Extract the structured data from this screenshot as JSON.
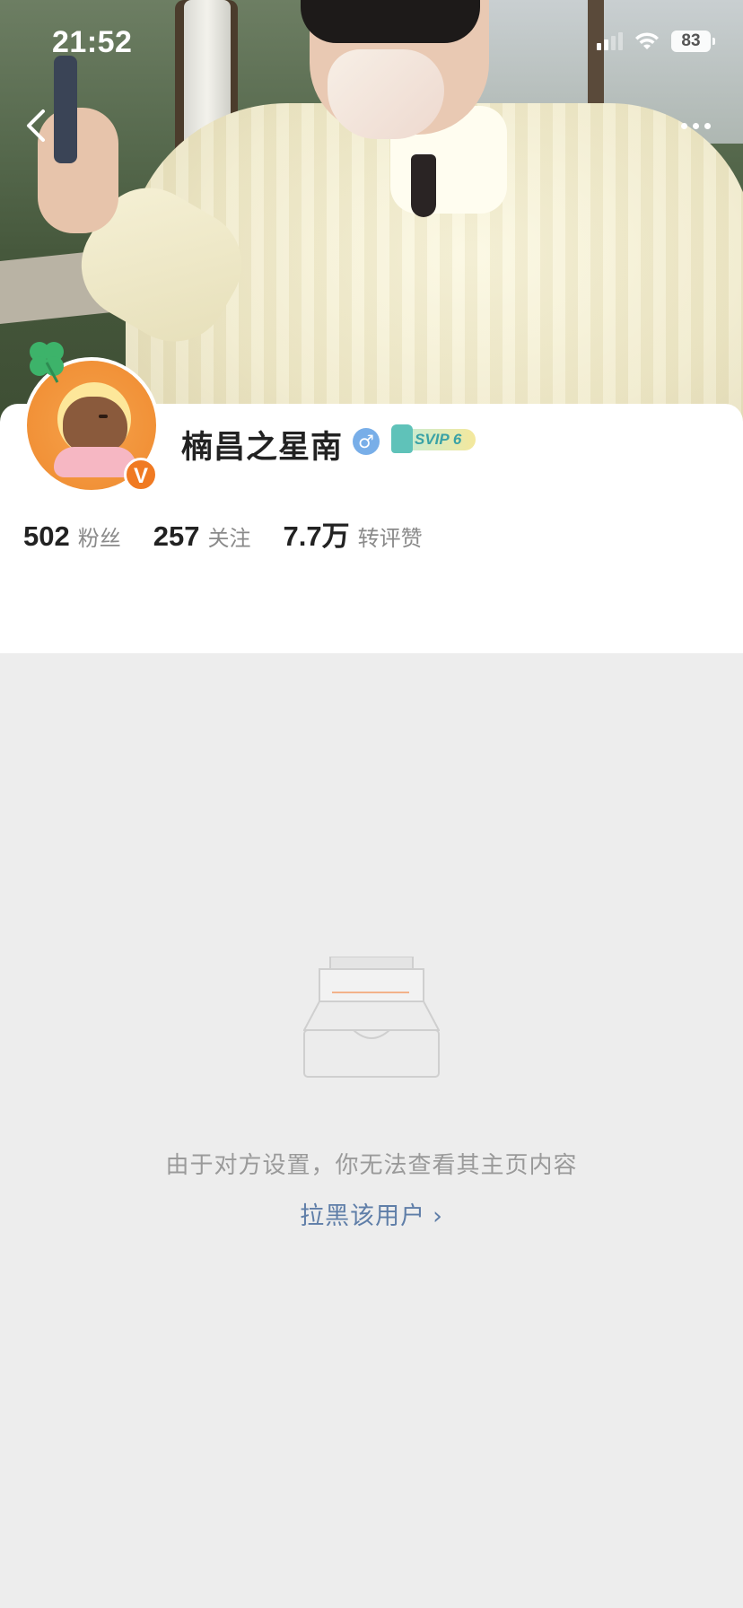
{
  "status_bar": {
    "time": "21:52",
    "battery": "83",
    "icons": [
      "signal-icon",
      "wifi-icon",
      "battery-icon"
    ]
  },
  "nav": {
    "back_icon": "chevron-left-icon",
    "more_icon": "ellipsis-icon"
  },
  "profile": {
    "name": "楠昌之星南",
    "gender_symbol": "♂",
    "vip_label": "SVIP 6",
    "verified_mark": "V",
    "stats": [
      {
        "value": "502",
        "label": "粉丝"
      },
      {
        "value": "257",
        "label": "关注"
      },
      {
        "value": "7.7万",
        "label": "转评赞"
      }
    ]
  },
  "empty_state": {
    "icon": "empty-inbox-icon",
    "message": "由于对方设置，你无法查看其主页内容",
    "action_label": "拉黑该用户",
    "action_icon": "chevron-right-icon"
  },
  "colors": {
    "accent_orange": "#f07a22",
    "link_blue": "#5f7ea8",
    "background": "#ededed"
  }
}
